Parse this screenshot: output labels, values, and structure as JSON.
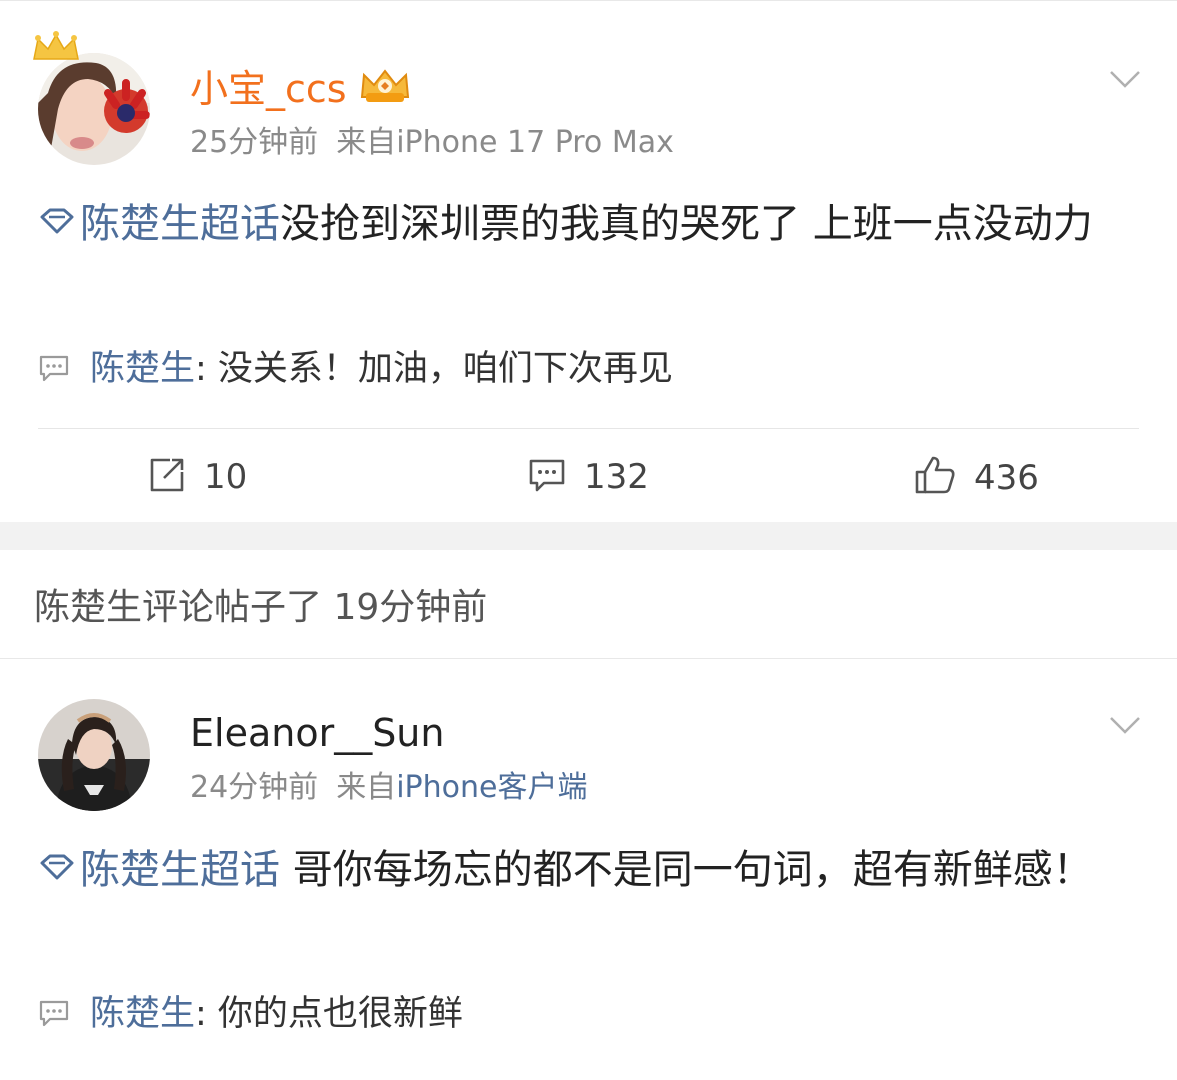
{
  "post1": {
    "username": "小宝_ccs",
    "time": "25分钟前",
    "source_prefix": "来自",
    "source": "iPhone 17 Pro Max",
    "topic": "陈楚生超话",
    "text": "没抢到深圳票的我真的哭死了 上班一点没动力",
    "reply": {
      "author": "陈楚生",
      "text": ": 没关系！加油，咱们下次再见"
    },
    "actions": {
      "repost_count": "10",
      "comment_count": "132",
      "like_count": "436"
    }
  },
  "section_header": "陈楚生评论帖子了 19分钟前",
  "post2": {
    "username": "Eleanor__Sun",
    "time": "24分钟前",
    "source_prefix": "来自",
    "source": "iPhone客户端",
    "topic": "陈楚生超话",
    "text": " 哥你每场忘的都不是同一句词，超有新鲜感！",
    "reply": {
      "author": "陈楚生",
      "text": ": 你的点也很新鲜"
    }
  },
  "colors": {
    "username_vip": "#f2701d",
    "link_blue": "#4e6e9a",
    "meta_gray": "#8a8a8a",
    "separator_band": "#f2f2f2"
  },
  "icons": {
    "topic": "super-topic-diamond-icon",
    "reply": "comment-bubble-icon",
    "repost": "repost-icon",
    "comment": "comment-icon",
    "like": "thumbs-up-icon",
    "more": "chevron-down-icon",
    "vip": "crown-vip-icon"
  }
}
